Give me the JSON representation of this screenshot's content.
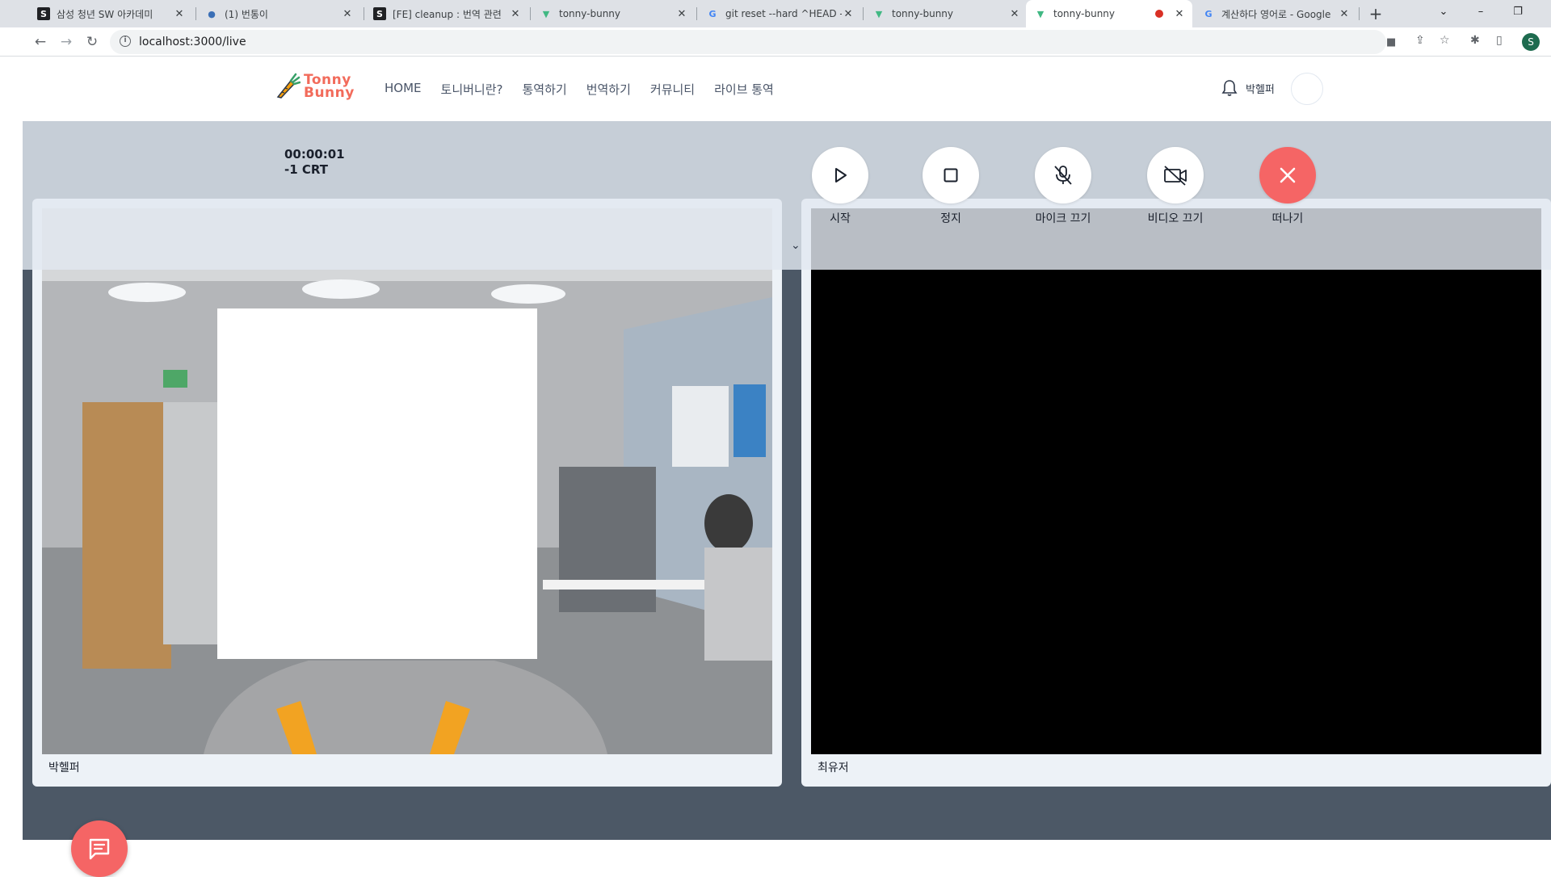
{
  "browser": {
    "tabs": [
      {
        "title": "삼성 청년 SW 아카데미",
        "favicon": "ssafy-icon"
      },
      {
        "title": "(1) 번통이",
        "favicon": "devtools-icon"
      },
      {
        "title": "[FE] cleanup : 번역 관련 ",
        "favicon": "ssafy-icon"
      },
      {
        "title": "tonny-bunny",
        "favicon": "vue-icon"
      },
      {
        "title": "git reset --hard ^HEAD - ",
        "favicon": "google-icon"
      },
      {
        "title": "tonny-bunny",
        "favicon": "vue-icon"
      },
      {
        "title": "tonny-bunny",
        "favicon": "vue-icon",
        "active": true,
        "recording": true
      },
      {
        "title": "계산하다 영어로 - Google",
        "favicon": "google-icon"
      }
    ],
    "url": "localhost:3000/live",
    "profile_initial": "S"
  },
  "header": {
    "logo_line1": "Tonny",
    "logo_line2": "Bunny",
    "nav": [
      "HOME",
      "토니버니란?",
      "통역하기",
      "번역하기",
      "커뮤니티",
      "라이브 통역"
    ],
    "username": "박헬퍼"
  },
  "controls": {
    "timer": "00:00:01",
    "credit": "-1 CRT",
    "buttons": [
      {
        "id": "start",
        "label": "시작",
        "icon": "play-icon"
      },
      {
        "id": "stop",
        "label": "정지",
        "icon": "stop-icon"
      },
      {
        "id": "mic-off",
        "label": "마이크 끄기",
        "icon": "mic-off-icon"
      },
      {
        "id": "video-off",
        "label": "비디오 끄기",
        "icon": "video-off-icon"
      },
      {
        "id": "leave",
        "label": "떠나기",
        "icon": "close-icon"
      }
    ]
  },
  "videos": {
    "local_name": "박헬퍼",
    "remote_name": "최유저"
  },
  "colors": {
    "brand": "#f26b5b",
    "leave": "#f56565",
    "page_bg": "#4c5866"
  }
}
